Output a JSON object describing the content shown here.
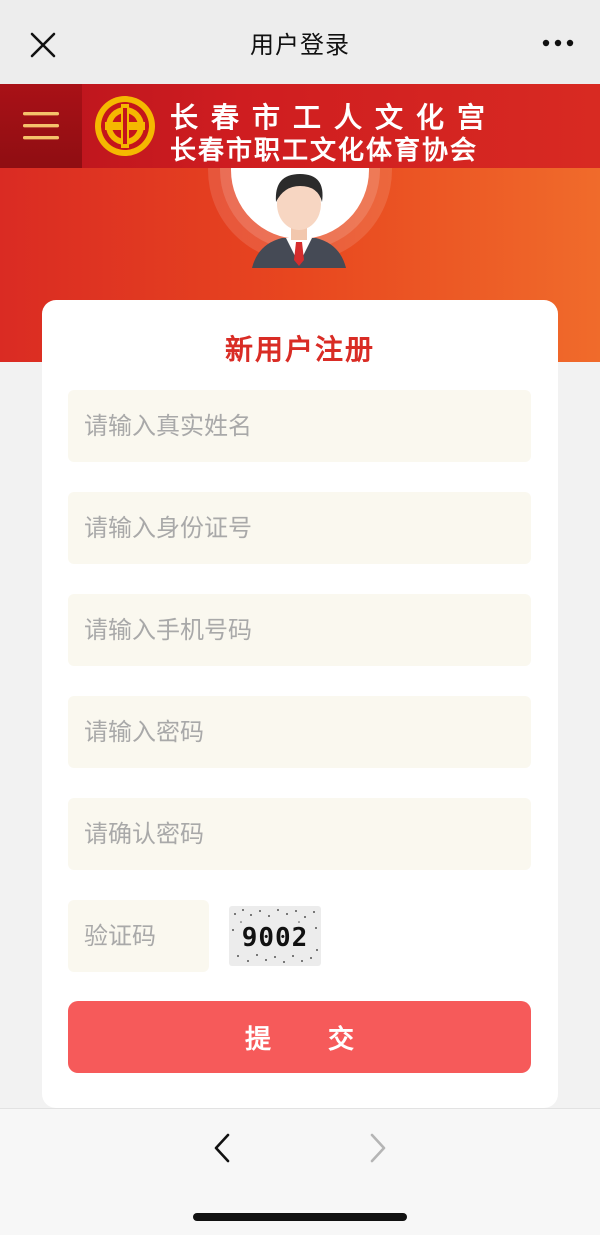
{
  "nav": {
    "title": "用户登录",
    "close_icon": "close-icon",
    "more_icon": "more-icon"
  },
  "banner": {
    "name_line1": "长春市工人文化宫",
    "name_line2": "长春市职工文化体育协会",
    "menu_icon": "hamburger-menu-icon",
    "logo_icon": "trade-union-logo-icon"
  },
  "form": {
    "heading": "新用户注册",
    "fields": {
      "name_placeholder": "请输入真实姓名",
      "id_placeholder": "请输入身份证号",
      "phone_placeholder": "请输入手机号码",
      "password_placeholder": "请输入密码",
      "confirm_placeholder": "请确认密码",
      "captcha_placeholder": "验证码"
    },
    "captcha_text": "9002",
    "submit_label": "提 交"
  },
  "colors": {
    "accent": "#d92c25",
    "submit": "#f65a5a",
    "input_bg": "#faf8ef"
  }
}
